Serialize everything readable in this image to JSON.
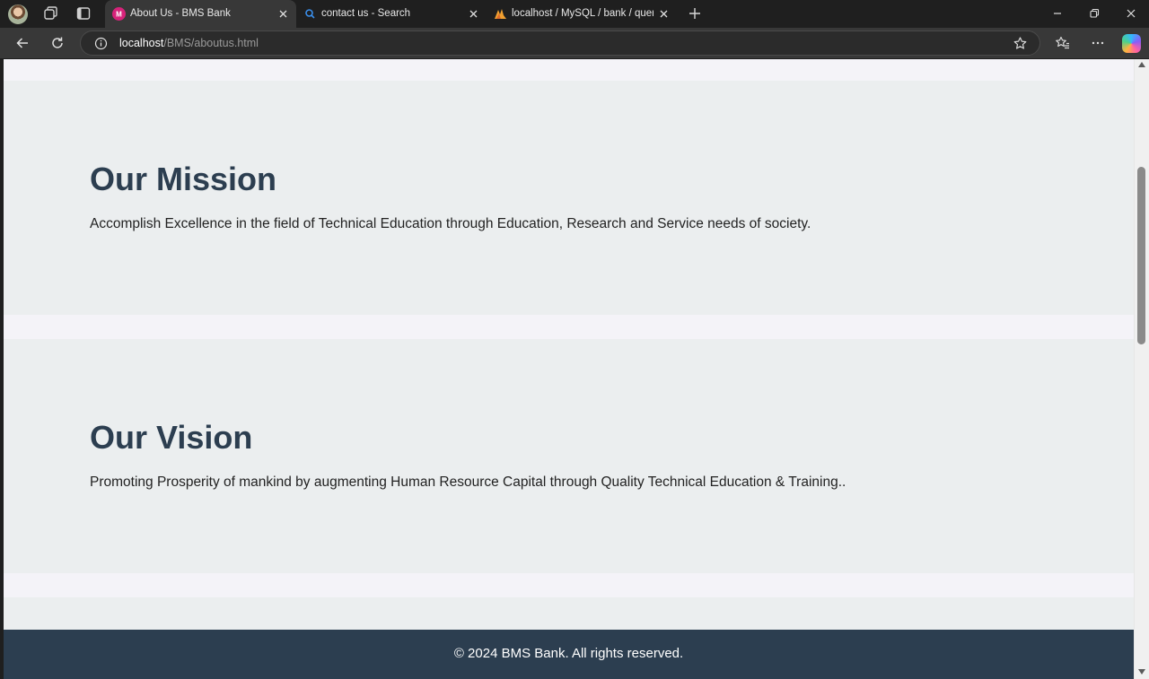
{
  "browser": {
    "tabs": [
      {
        "title": "About Us - BMS Bank",
        "active": true,
        "favicon": "bms-favicon-icon"
      },
      {
        "title": "contact us - Search",
        "active": false,
        "favicon": "search-icon"
      },
      {
        "title": "localhost / MySQL / bank / queries",
        "active": false,
        "favicon": "phpmyadmin-icon"
      }
    ],
    "address": {
      "host": "localhost",
      "path": "/BMS/aboutus.html"
    }
  },
  "page": {
    "mission": {
      "heading": "Our Mission",
      "text": "Accomplish Excellence in the field of Technical Education through Education, Research and Service needs of society."
    },
    "vision": {
      "heading": "Our Vision",
      "text": "Promoting Prosperity of mankind by augmenting Human Resource Capital through Quality Technical Education & Training.."
    },
    "footer": {
      "text": "© 2024 BMS Bank. All rights reserved."
    }
  },
  "colors": {
    "heading": "#2c3e50",
    "section_bg": "#ebeeef",
    "page_bg": "#f4f3f8",
    "footer_bg": "#2c3e50"
  }
}
